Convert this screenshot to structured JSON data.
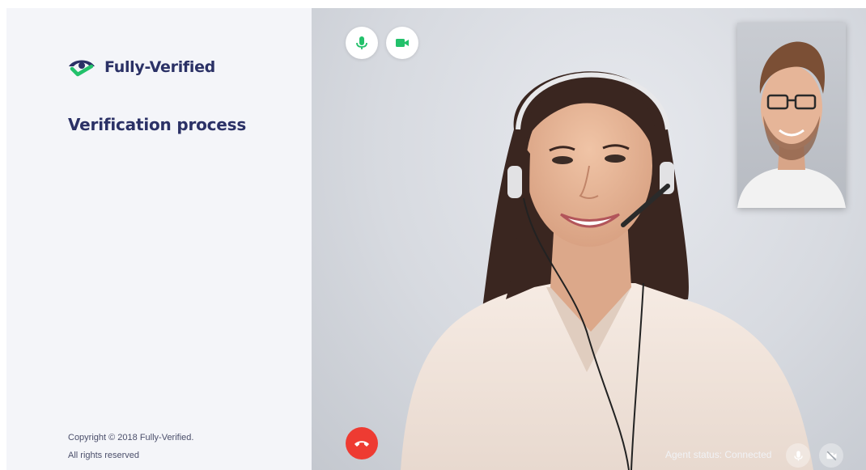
{
  "brand": {
    "name": "Fully-Verified",
    "logo_icon": "eye-check-icon",
    "primary_color": "#2b3166",
    "accent_color": "#23c16b"
  },
  "page": {
    "title": "Verification process"
  },
  "footer": {
    "copyright": "Copyright © 2018 Fully-Verified.",
    "rights": "All rights reserved"
  },
  "call": {
    "top_controls": [
      {
        "name": "microphone-button",
        "icon": "microphone-icon",
        "color": "#23c16b"
      },
      {
        "name": "camera-button",
        "icon": "video-camera-icon",
        "color": "#23c16b"
      }
    ],
    "hangup": {
      "icon": "phone-hangup-icon",
      "color": "#ee3b32"
    },
    "agent_status": "Agent status: Connected",
    "agent_controls": [
      {
        "name": "agent-microphone-indicator",
        "icon": "microphone-icon"
      },
      {
        "name": "agent-camera-off-indicator",
        "icon": "video-camera-off-icon"
      }
    ]
  }
}
